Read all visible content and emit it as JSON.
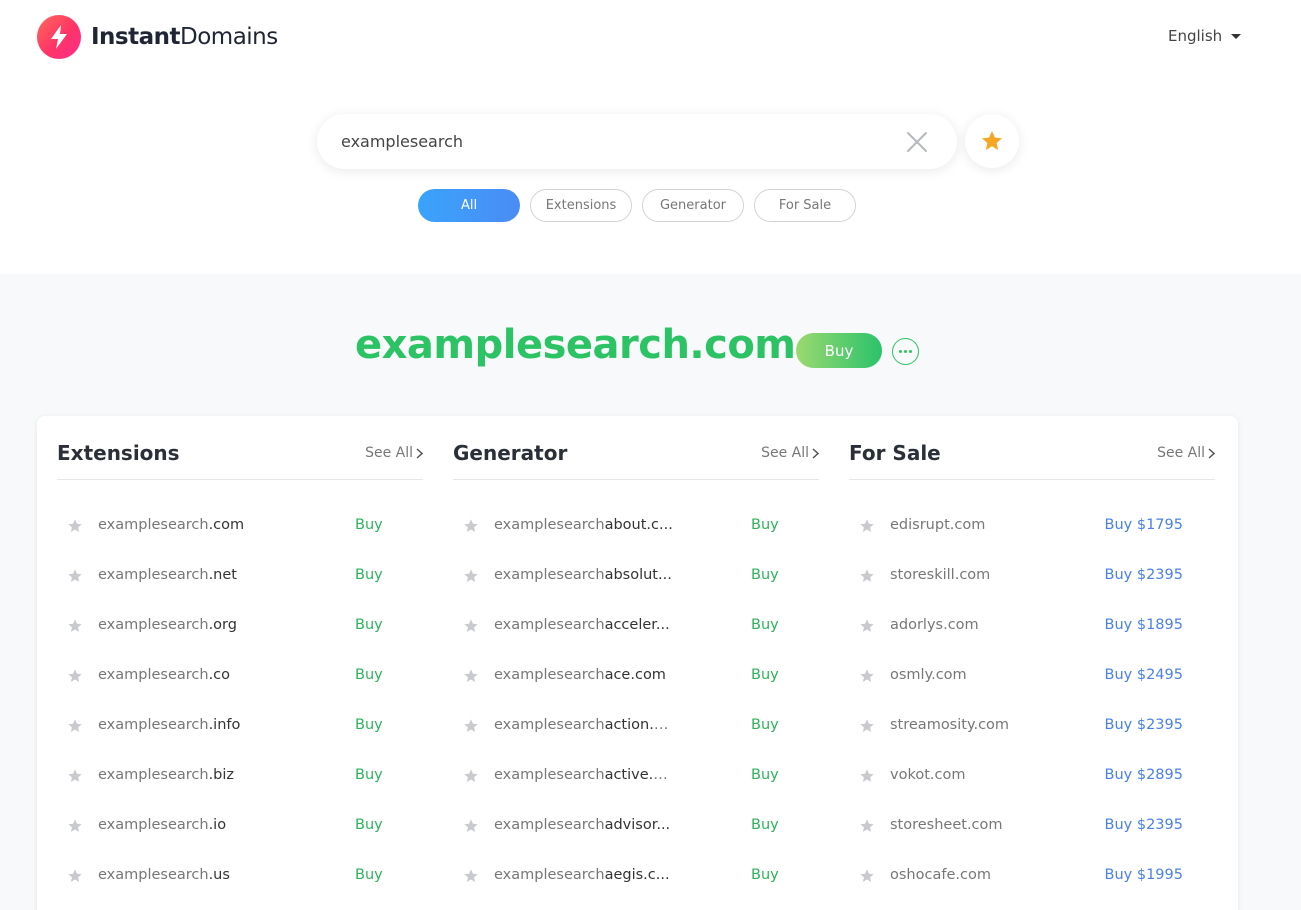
{
  "brand": {
    "name_bold": "Instant",
    "name_regular": "Domains"
  },
  "language": {
    "label": "English"
  },
  "search": {
    "value": "examplesearch",
    "placeholder": ""
  },
  "filters": [
    {
      "label": "All",
      "active": true
    },
    {
      "label": "Extensions",
      "active": false
    },
    {
      "label": "Generator",
      "active": false
    },
    {
      "label": "For Sale",
      "active": false
    }
  ],
  "hero": {
    "domain": "examplesearch.com",
    "buy_label": "Buy"
  },
  "columns": {
    "extensions": {
      "title": "Extensions",
      "see_all": "See All",
      "rows": [
        {
          "base": "examplesearch",
          "suffix": ".com",
          "action": "Buy"
        },
        {
          "base": "examplesearch",
          "suffix": ".net",
          "action": "Buy"
        },
        {
          "base": "examplesearch",
          "suffix": ".org",
          "action": "Buy"
        },
        {
          "base": "examplesearch",
          "suffix": ".co",
          "action": "Buy"
        },
        {
          "base": "examplesearch",
          "suffix": ".info",
          "action": "Buy"
        },
        {
          "base": "examplesearch",
          "suffix": ".biz",
          "action": "Buy"
        },
        {
          "base": "examplesearch",
          "suffix": ".io",
          "action": "Buy"
        },
        {
          "base": "examplesearch",
          "suffix": ".us",
          "action": "Buy"
        }
      ]
    },
    "generator": {
      "title": "Generator",
      "see_all": "See All",
      "rows": [
        {
          "base": "examplesearch",
          "suffix": "about.c...",
          "action": "Buy"
        },
        {
          "base": "examplesearch",
          "suffix": "absolut...",
          "action": "Buy"
        },
        {
          "base": "examplesearch",
          "suffix": "acceler...",
          "action": "Buy"
        },
        {
          "base": "examplesearch",
          "suffix": "ace.com",
          "action": "Buy"
        },
        {
          "base": "examplesearch",
          "suffix": "action.c...",
          "action": "Buy"
        },
        {
          "base": "examplesearch",
          "suffix": "active.c...",
          "action": "Buy"
        },
        {
          "base": "examplesearch",
          "suffix": "advisor...",
          "action": "Buy"
        },
        {
          "base": "examplesearch",
          "suffix": "aegis.c...",
          "action": "Buy"
        }
      ]
    },
    "for_sale": {
      "title": "For Sale",
      "see_all": "See All",
      "rows": [
        {
          "name": "edisrupt.com",
          "action": "Buy $1795"
        },
        {
          "name": "storeskill.com",
          "action": "Buy $2395"
        },
        {
          "name": "adorlys.com",
          "action": "Buy $1895"
        },
        {
          "name": "osmly.com",
          "action": "Buy $2495"
        },
        {
          "name": "streamosity.com",
          "action": "Buy $2395"
        },
        {
          "name": "vokot.com",
          "action": "Buy $2895"
        },
        {
          "name": "storesheet.com",
          "action": "Buy $2395"
        },
        {
          "name": "oshocafe.com",
          "action": "Buy $1995"
        }
      ]
    }
  },
  "icons": {
    "logo": "lightning-bolt-icon",
    "clear": "close-icon",
    "favorites": "star-icon",
    "more": "more-dots-icon",
    "row_star": "star-icon",
    "see_all": "chevron-right-icon"
  },
  "colors": {
    "brand_pink": "#ff3366",
    "accent_blue": "#3aa3fb",
    "available_green": "#2cc364",
    "price_blue": "#4a80e8",
    "favorite_orange": "#f5a623"
  }
}
